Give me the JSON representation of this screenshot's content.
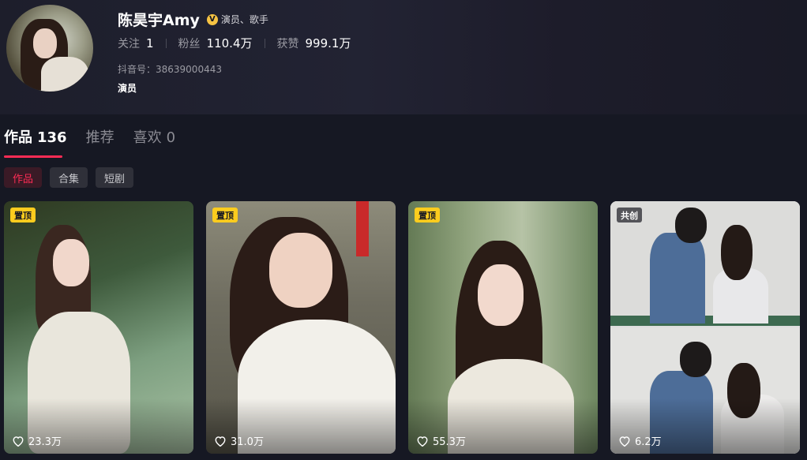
{
  "profile": {
    "name": "陈昊宇Amy",
    "verify_text": "演员、歌手",
    "stats": [
      {
        "label": "关注",
        "value": "1"
      },
      {
        "label": "粉丝",
        "value": "110.4万"
      },
      {
        "label": "获赞",
        "value": "999.1万"
      }
    ],
    "douyin_id": "抖音号：38639000443",
    "bio": "演员"
  },
  "tabs": [
    {
      "label": "作品",
      "count": "136"
    },
    {
      "label": "推荐",
      "count": ""
    },
    {
      "label": "喜欢",
      "count": "0"
    }
  ],
  "chips": [
    "作品",
    "合集",
    "短剧"
  ],
  "videos": [
    {
      "badge": "置顶",
      "likes": "23.3万"
    },
    {
      "badge": "置顶",
      "likes": "31.0万"
    },
    {
      "badge": "置顶",
      "likes": "55.3万"
    },
    {
      "badge": "共创",
      "likes": "6.2万"
    }
  ],
  "colors": {
    "accent": "#fe2c55",
    "pin_badge": "#fccc1e",
    "background": "#161823"
  }
}
